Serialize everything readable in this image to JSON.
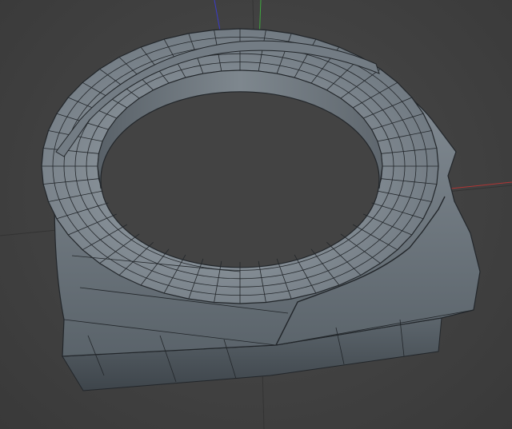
{
  "viewport": {
    "background_color": "#414141",
    "grid_color": "#303030",
    "axis_colors": {
      "x": "#b03535",
      "y": "#3fa83f",
      "z": "#3b3bc8"
    }
  },
  "mesh": {
    "object_type": "ring-with-flat-base",
    "surface_color": "#7d8790",
    "shadow_color": "#4e565d",
    "highlight_color": "#9aa3aa",
    "wire_color": "#22262a",
    "ring_segments": 48,
    "ring_loops": 5
  }
}
